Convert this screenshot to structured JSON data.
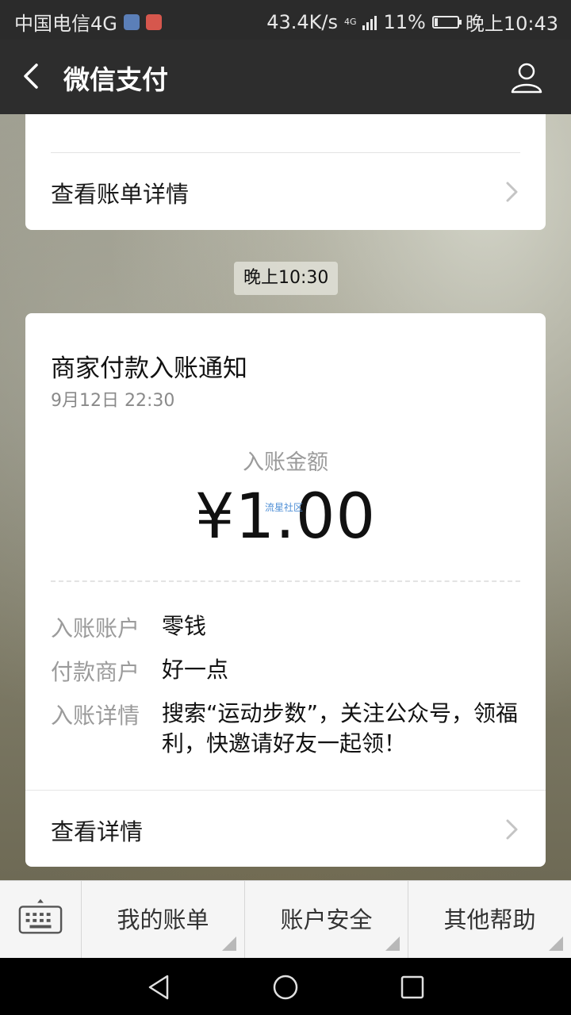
{
  "status_bar": {
    "carrier": "中国电信4G",
    "speed": "43.4K/s",
    "network": "4G",
    "battery": "11%",
    "time": "晚上10:43"
  },
  "nav": {
    "title": "微信支付"
  },
  "card_prev": {
    "link": "查看账单详情"
  },
  "timestamp_pill": "晚上10:30",
  "notice": {
    "title": "商家付款入账通知",
    "date": "9月12日  22:30",
    "amount_label": "入账金额",
    "amount": "¥1.00",
    "watermark": "流星社区",
    "rows": [
      {
        "key": "入账账户",
        "value": "零钱"
      },
      {
        "key": "付款商户",
        "value": "好一点"
      },
      {
        "key": "入账详情",
        "value": "搜索“运动步数”，关注公众号，领福利，快邀请好友一起领！"
      }
    ],
    "link": "查看详情"
  },
  "menu": {
    "items": [
      "我的账单",
      "账户安全",
      "其他帮助"
    ]
  },
  "icons": {
    "back": "chevron-left-icon",
    "user": "user-icon",
    "keyboard": "keyboard-icon",
    "sys_back": "triangle-back-icon",
    "sys_home": "circle-home-icon",
    "sys_recent": "square-recent-icon"
  },
  "colors": {
    "navbar": "#2d2d2d",
    "card": "#ffffff",
    "muted_text": "#9b9b9b"
  }
}
